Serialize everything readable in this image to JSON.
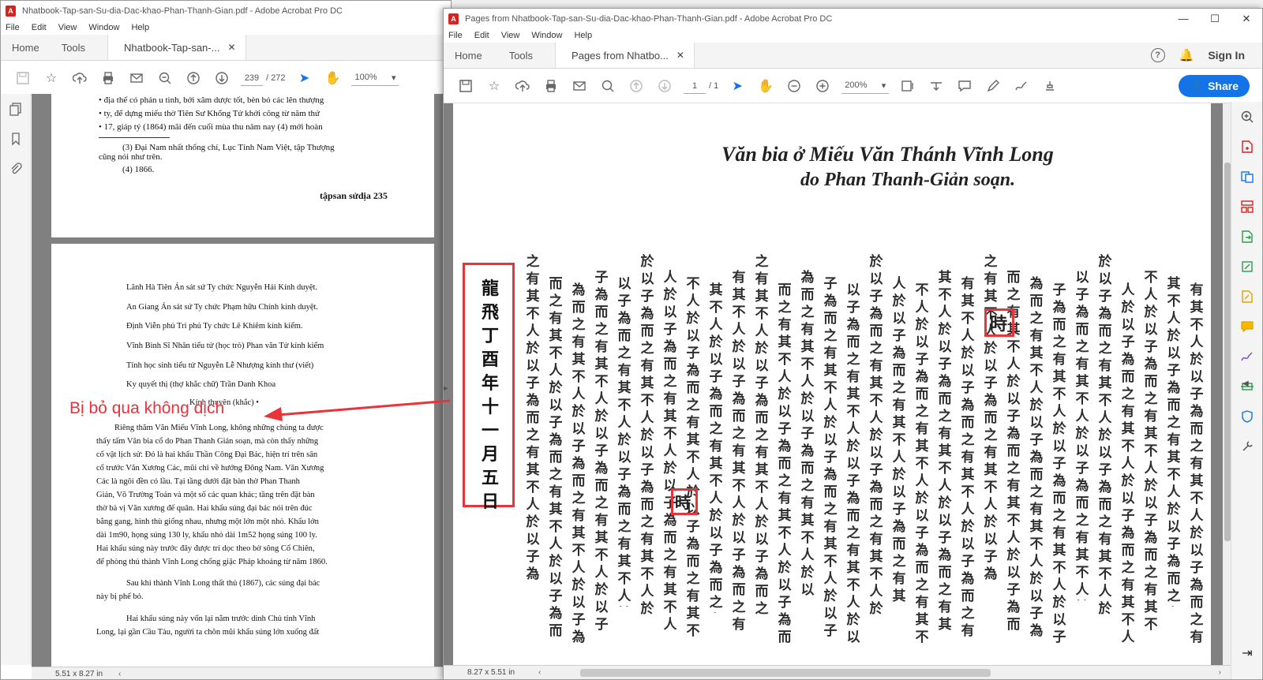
{
  "back_window": {
    "title": "Nhatbook-Tap-san-Su-dia-Dac-khao-Phan-Thanh-Gian.pdf - Adobe Acrobat Pro DC",
    "menu": [
      "File",
      "Edit",
      "View",
      "Window",
      "Help"
    ],
    "tabs": {
      "home": "Home",
      "tools": "Tools",
      "doc": "Nhatbook-Tap-san-..."
    },
    "page_current": "239",
    "page_total": "/ 272",
    "zoom": "100%",
    "status_size": "5.51 x 8.27 in",
    "page1_lines": [
      "• địa thế có phản u tinh, bởi xâm dược tốt, bèn bỏ các lên thượng",
      "• ty, để dựng miếu thờ Tiên Sư Khổng Tử khởi công từ năm thứ",
      "• 17, giáp tý (1864) mãi đến cuối mùa thu năm nay (4) mới hoàn",
      "(3) Đại Nam nhất thống chí, Lục Tỉnh Nam Việt, tập Thượng",
      "cũng nói như trên.",
      "(4) 1866."
    ],
    "page1_footer": "tậpsan sửdịa 235",
    "page2_lines": [
      "Lãnh Hà Tiên Án sát sứ Ty chức Nguyễn Hải Kính duyệt.",
      "An Giang Án sát sứ Ty chức Phạm hữu Chính kính duyệt.",
      "Định Viễn phủ Tri phủ Ty chức Lê Khiêm kính kiểm.",
      "Vĩnh Bình Sĩ Nhân tiểu tử (học trò) Phan văn Tử kính kiểm",
      "Tỉnh học sinh tiểu tử Nguyễn Lễ Nhượng kính thư (viết)",
      "Ky quyết thị (thợ khắc chữ)   Trần Danh Khoa",
      "Kính   thuyên (khắc) •",
      "Riêng thăm Văn Miếu Vĩnh Long, không những chúng ta được",
      "thấy tấm Văn bia cổ do Phan Thanh Giản soạn, mà còn thấy những",
      "cổ vật lịch sử: Đó là hai khẩu Thần Công Đại Bác, hiện trí trên sân",
      "cổ trước Văn Xương Các, mũi chỉ về hướng Đông Nam. Văn Xương",
      "Các là ngôi đền có lầu. Tại tầng dưới đặt bàn thờ Phan Thanh",
      "Giản, Võ Trường Toản và một số các quan khác; tầng trên đặt bàn",
      "thờ bà vị Văn xương đế quân. Hai khẩu súng đại bác nói trên đúc",
      "bằng gang, hình thù giống nhau, nhưng một lớn một nhỏ. Khẩu lớn",
      "dài 1m90, họng súng 130 ly, khẩu nhỏ dài 1m52 họng súng 100 ly.",
      "Hai khẩu súng này trước đây được trí dọc theo bờ sông Cổ Chiên,",
      "để phòng thủ thành Vĩnh Long chống giặc Pháp khoảng từ năm 1860.",
      "Sau khi thành Vĩnh Long thất thủ (1867), các súng đại bác",
      "này bị phế bỏ.",
      "Hai khẩu súng này vốn lại nằm trước dinh Chủ tỉnh Vĩnh",
      "Long, lại gần Cầu Tàu, người ta chôn mũi khẩu súng lớn xuống đất"
    ]
  },
  "front_window": {
    "title": "Pages from Nhatbook-Tap-san-Su-dia-Dac-khao-Phan-Thanh-Gian.pdf - Adobe Acrobat Pro DC",
    "menu": [
      "File",
      "Edit",
      "View",
      "Window",
      "Help"
    ],
    "tabs": {
      "home": "Home",
      "tools": "Tools",
      "doc": "Pages from Nhatbo..."
    },
    "sign_in": "Sign In",
    "share": "Share",
    "page_current": "1",
    "page_total": "/ 1",
    "zoom": "200%",
    "status_size": "8.27 x 5.51 in",
    "heading_line1": "Văn bia ở Miếu Văn Thánh Vĩnh Long",
    "heading_line2": "do Phan Thanh-Giản soạn.",
    "boxed_cjk": "龍飛丁酉年十一月五日",
    "highlight_char": "時"
  },
  "annotation": {
    "callout_text": "Bị bỏ qua không dịch",
    "color": "#e8333a"
  },
  "colors": {
    "accent": "#1473e6",
    "acrobat_red": "#d7221e"
  }
}
